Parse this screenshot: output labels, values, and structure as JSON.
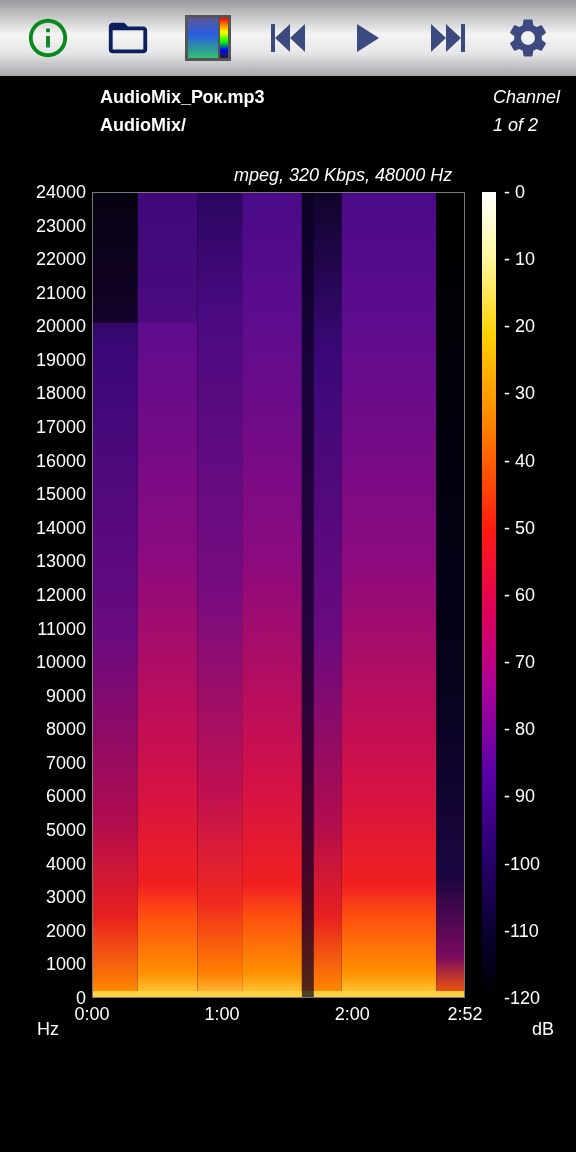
{
  "file": {
    "name": "AudioMix_Рок.mp3",
    "folder": "AudioMix/"
  },
  "channel": {
    "label": "Channel",
    "value": "1 of 2"
  },
  "format": "mpeg, 320 Kbps, 48000 Hz",
  "y_labels": [
    "24000",
    "23000",
    "22000",
    "21000",
    "20000",
    "19000",
    "18000",
    "17000",
    "16000",
    "15000",
    "14000",
    "13000",
    "12000",
    "11000",
    "10000",
    "9000",
    "8000",
    "7000",
    "6000",
    "5000",
    "4000",
    "3000",
    "2000",
    "1000",
    "0"
  ],
  "x_labels": [
    "0:00",
    "1:00",
    "2:00",
    "2:52"
  ],
  "y_unit": "Hz",
  "db_labels": [
    "- 0",
    "- 10",
    "- 20",
    "- 30",
    "- 40",
    "- 50",
    "- 60",
    "- 70",
    "- 80",
    "- 90",
    "-100",
    "-110",
    "-120"
  ],
  "db_unit": "dB"
}
